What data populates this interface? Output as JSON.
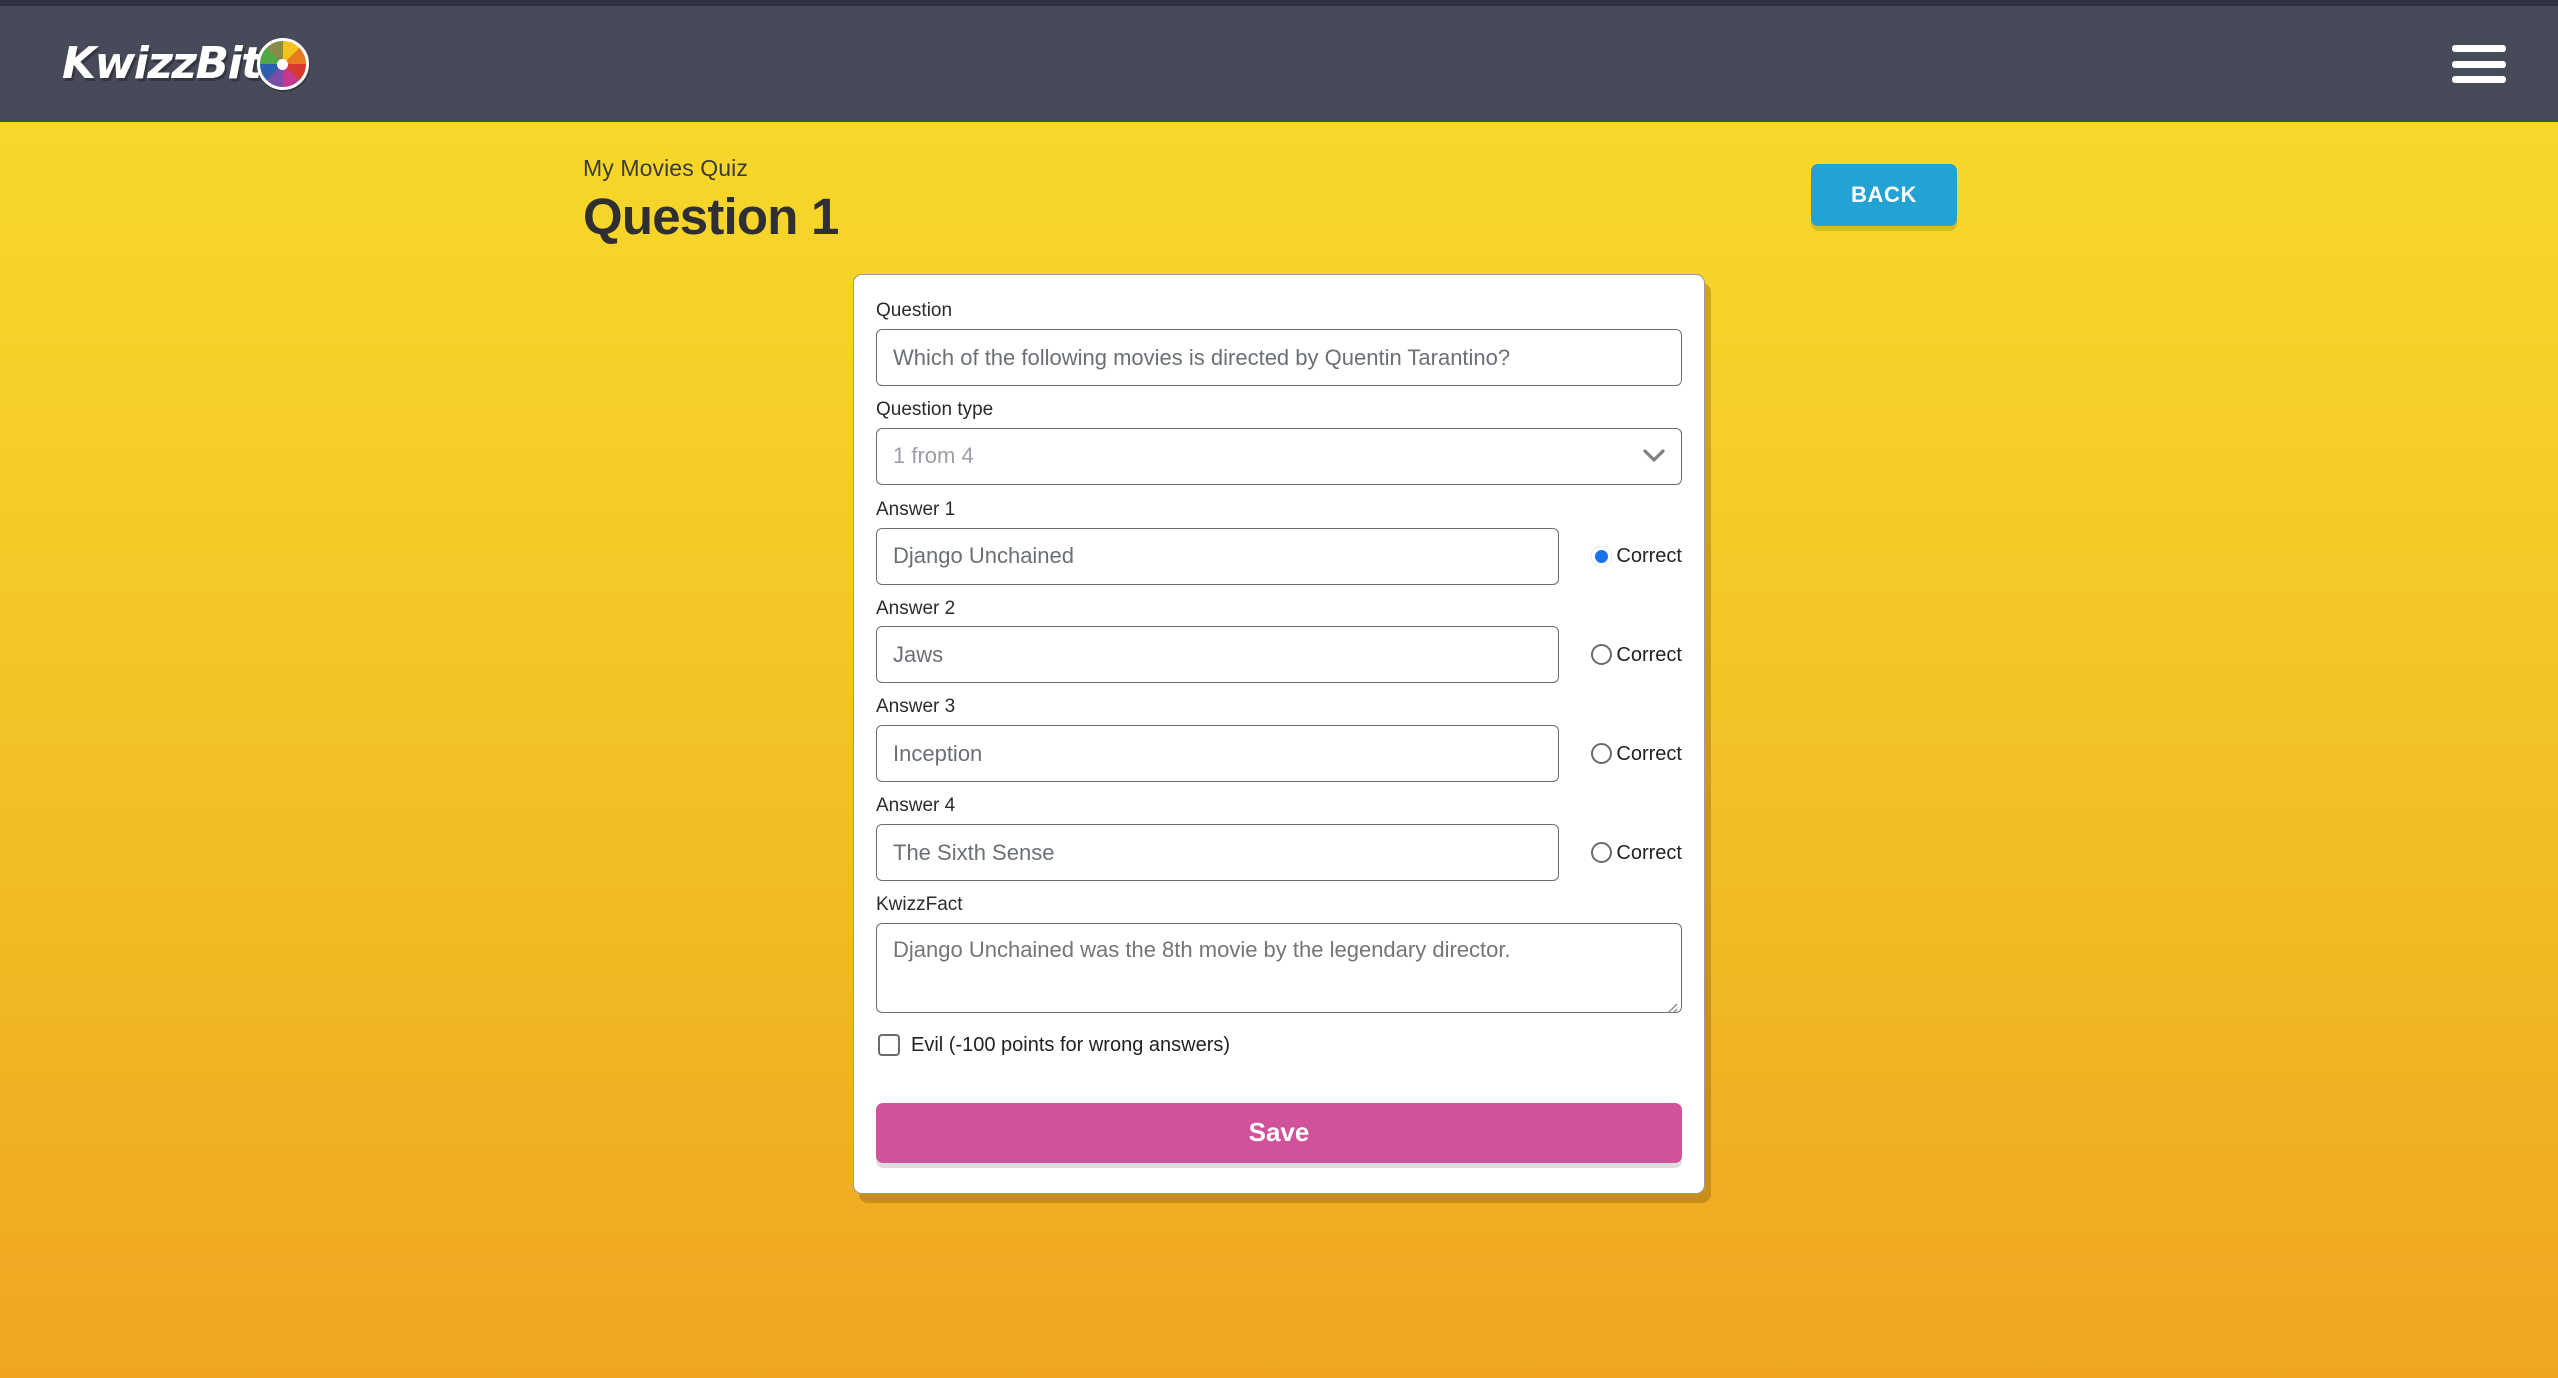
{
  "brand": {
    "name": "KwizzBit",
    "wheel_icon": "color-wheel-icon",
    "wheel_colors": [
      "#F2C31A",
      "#E87B22",
      "#D8392E",
      "#C2398E",
      "#7B4BA8",
      "#2E5FAE",
      "#4FA845",
      "#8A8A4A"
    ]
  },
  "header": {
    "background": "#474A58",
    "menu_icon": "hamburger-menu-icon"
  },
  "page": {
    "quiz_name": "My Movies Quiz",
    "title": "Question 1",
    "background_top": "#F8DB2C",
    "background_bottom": "#EFA522",
    "back_button": "BACK",
    "back_button_color": "#22A3D4"
  },
  "form": {
    "question": {
      "label": "Question",
      "value": "Which of the following movies is directed by Quentin Tarantino?"
    },
    "question_type": {
      "label": "Question type",
      "value": "1 from 4",
      "chevron_icon": "chevron-down-icon"
    },
    "answers": [
      {
        "label": "Answer 1",
        "value": "Django Unchained",
        "correct_label": "Correct",
        "correct": true
      },
      {
        "label": "Answer 2",
        "value": "Jaws",
        "correct_label": "Correct",
        "correct": false
      },
      {
        "label": "Answer 3",
        "value": "Inception",
        "correct_label": "Correct",
        "correct": false
      },
      {
        "label": "Answer 4",
        "value": "The Sixth Sense",
        "correct_label": "Correct",
        "correct": false
      }
    ],
    "kwizzfact": {
      "label": "KwizzFact",
      "value": "Django Unchained was the 8th movie by the legendary director."
    },
    "evil": {
      "label": "Evil (-100 points for wrong answers)",
      "checked": false
    },
    "save_button": "Save",
    "save_button_color": "#D1519A",
    "radio_accent": "#1a73e8"
  }
}
